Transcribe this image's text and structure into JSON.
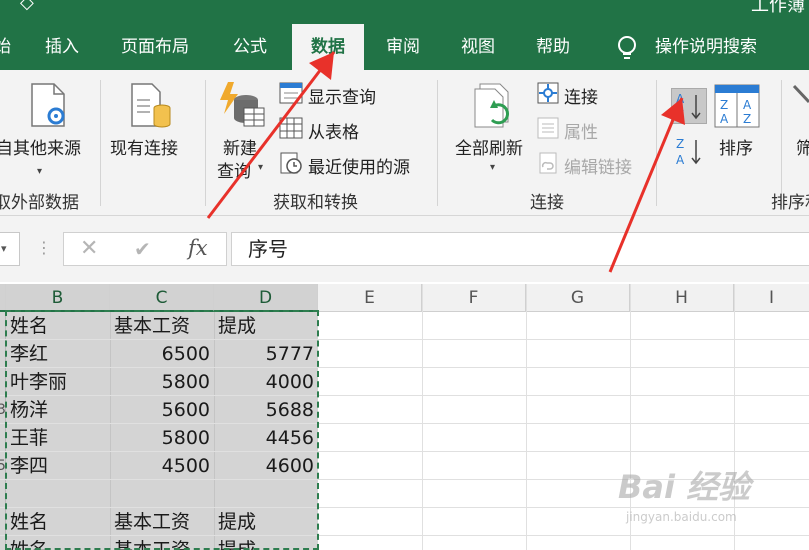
{
  "title_bar": {
    "left_glyph": "◇",
    "title_fragment": "工作簿"
  },
  "tabs": [
    {
      "label": "始",
      "active": false
    },
    {
      "label": "插入",
      "active": false
    },
    {
      "label": "页面布局",
      "active": false
    },
    {
      "label": "公式",
      "active": false
    },
    {
      "label": "数据",
      "active": true
    },
    {
      "label": "审阅",
      "active": false
    },
    {
      "label": "视图",
      "active": false
    },
    {
      "label": "帮助",
      "active": false
    }
  ],
  "tell_me": {
    "label": "操作说明搜索",
    "icon": "lightbulb-icon"
  },
  "ribbon": {
    "get_external": {
      "other_sources_label": "自其他来源",
      "existing_connections_label": "现有连接",
      "group_label": "取外部数据"
    },
    "get_transform": {
      "new_query_label_line1": "新建",
      "new_query_label_line2": "查询",
      "show_queries_label": "显示查询",
      "from_table_label": "从表格",
      "recent_sources_label": "最近使用的源",
      "group_label": "获取和转换"
    },
    "connections": {
      "refresh_all_label": "全部刷新",
      "connections_label": "连接",
      "properties_label": "属性",
      "edit_links_label": "编辑链接",
      "group_label": "连接"
    },
    "sort_filter": {
      "sort_az_icon": "sort-ascending-icon",
      "sort_za_icon": "sort-descending-icon",
      "sort_label": "排序",
      "filter_label_fragment": "筛",
      "group_label_fragment": "排序和"
    }
  },
  "formula_bar": {
    "name_box_caret": "▾",
    "cancel_glyph": "✕",
    "enter_glyph": "✔",
    "fx_label": "fx",
    "content": "序号"
  },
  "columns": [
    "B",
    "C",
    "D",
    "E",
    "F",
    "G",
    "H",
    "I"
  ],
  "rows": [
    {
      "row_tail": "",
      "b": "姓名",
      "c": "基本工资",
      "d": "提成"
    },
    {
      "row_tail": "",
      "b": "李红",
      "c": "6500",
      "d": "5777"
    },
    {
      "row_tail": "",
      "b": "叶李丽",
      "c": "5800",
      "d": "4000"
    },
    {
      "row_tail": "3",
      "b": "杨洋",
      "c": "5600",
      "d": "5688"
    },
    {
      "row_tail": "",
      "b": "王菲",
      "c": "5800",
      "d": "4456"
    },
    {
      "row_tail": "5",
      "b": "李四",
      "c": "4500",
      "d": "4600"
    },
    {
      "row_tail": "",
      "b": "",
      "c": "",
      "d": ""
    },
    {
      "row_tail": "",
      "b": "姓名",
      "c": "基本工资",
      "d": "提成"
    },
    {
      "row_tail": "",
      "b": "姓名",
      "c": "基本工资",
      "d": "提成"
    }
  ],
  "watermark": {
    "main": "Bai 经验",
    "sub": "jingyan.baidu.com"
  },
  "colors": {
    "excel_green": "#217346",
    "ribbon_bg": "#f3f3f3",
    "selection_gray": "#d4d4d4",
    "arrow_red": "#e8312a"
  }
}
